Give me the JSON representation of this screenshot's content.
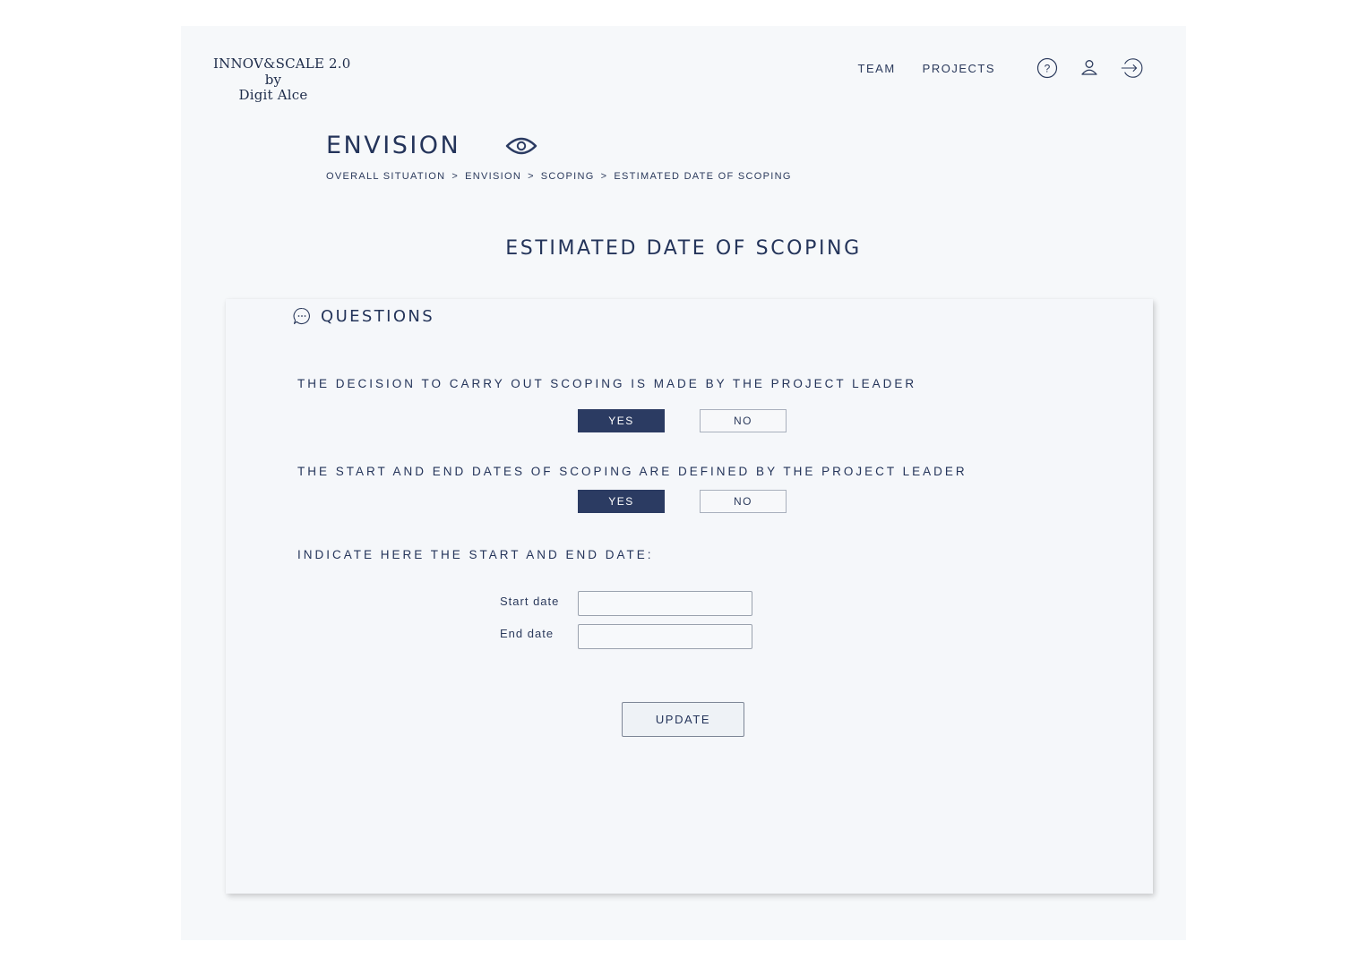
{
  "brand": {
    "line1": "INNOV&SCALE 2.0",
    "line2": "by",
    "line3": "Digit Alce"
  },
  "nav": {
    "team": "TEAM",
    "projects": "PROJECTS",
    "icons": [
      "help-icon",
      "user-icon",
      "logout-icon"
    ]
  },
  "header": {
    "title": "ENVISION",
    "icon": "eye-icon"
  },
  "breadcrumb": {
    "items": [
      "OVERALL SITUATION",
      "ENVISION",
      "SCOPING",
      "ESTIMATED DATE OF SCOPING"
    ],
    "separator": ">"
  },
  "section_title": "ESTIMATED DATE OF SCOPING",
  "card": {
    "heading": "QUESTIONS",
    "heading_icon": "chat-bubble-icon",
    "questions": [
      {
        "text": "THE DECISION TO CARRY OUT SCOPING IS MADE BY THE PROJECT LEADER",
        "yes_label": "YES",
        "no_label": "NO",
        "selected": "YES"
      },
      {
        "text": "THE START AND END DATES OF SCOPING ARE DEFINED BY THE PROJECT LEADER",
        "yes_label": "YES",
        "no_label": "NO",
        "selected": "YES"
      }
    ],
    "date_prompt": "INDICATE HERE THE START AND END DATE:",
    "start_date": {
      "label": "Start date",
      "value": ""
    },
    "end_date": {
      "label": "End date",
      "value": ""
    },
    "update_label": "UPDATE"
  },
  "colors": {
    "primary": "#2b3b62",
    "text": "#24345a",
    "page_bg": "#f6f8fa"
  }
}
